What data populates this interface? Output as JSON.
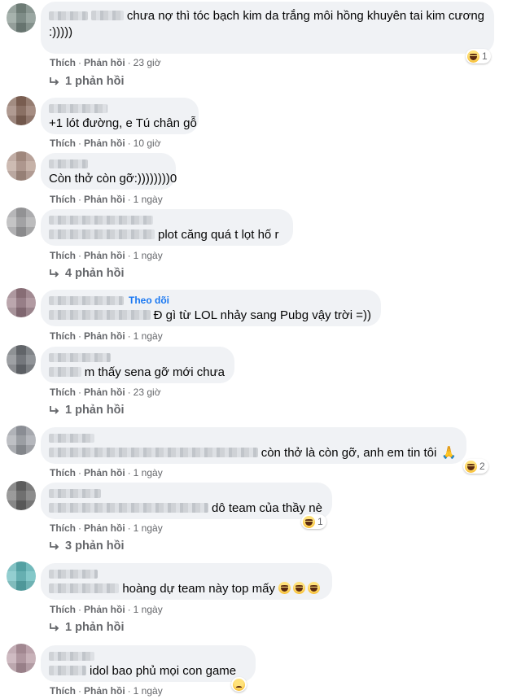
{
  "comments": [
    {
      "avatar_color": "#7c8c86",
      "lines": [
        {
          "text": "chưa nợ thì tóc bạch kim da trắng môi hồng khuyên tai kim cương"
        },
        {
          "text": ":)))))"
        }
      ],
      "actions": {
        "like": "Thích",
        "reply": "Phản hồi",
        "time": "23 giờ"
      },
      "reaction": {
        "icon": "haha-icon",
        "count": "1"
      },
      "replies": "1 phản hồi"
    },
    {
      "avatar_color": "#8a6a5c",
      "lines": [
        {
          "text": ""
        },
        {
          "text": "+1 lót đường, e Tú chân gỗ"
        }
      ],
      "actions": {
        "like": "Thích",
        "reply": "Phản hồi",
        "time": "10 giờ"
      }
    },
    {
      "avatar_color": "#b59a8e",
      "lines": [
        {
          "text": ""
        },
        {
          "text": "Còn thở còn gỡ:))))))))0"
        }
      ],
      "actions": {
        "like": "Thích",
        "reply": "Phản hồi",
        "time": "1 ngày"
      }
    },
    {
      "avatar_color": "#a7a7a9",
      "lines": [
        {
          "text": ""
        },
        {
          "text": "plot căng quá t lọt hố r"
        }
      ],
      "actions": {
        "like": "Thích",
        "reply": "Phản hồi",
        "time": "1 ngày"
      },
      "replies": "4 phản hồi"
    },
    {
      "avatar_color": "#9a7c86",
      "lines": [
        {
          "text": "",
          "follow": "Theo dõi"
        },
        {
          "text": "Đ gì từ LOL nhảy sang Pubg vậy trời =))"
        }
      ],
      "actions": {
        "like": "Thích",
        "reply": "Phản hồi",
        "time": "1 ngày"
      }
    },
    {
      "avatar_color": "#6f7378",
      "lines": [
        {
          "text": ""
        },
        {
          "text": "m thấy sena gỡ mới chưa"
        }
      ],
      "actions": {
        "like": "Thích",
        "reply": "Phản hồi",
        "time": "23 giờ"
      },
      "replies": "1 phản hồi"
    },
    {
      "avatar_color": "#9ea1a8",
      "lines": [
        {
          "text": ""
        },
        {
          "text": "còn thở là còn gỡ, anh em tin tôi",
          "emoji": "🙏"
        }
      ],
      "actions": {
        "like": "Thích",
        "reply": "Phản hồi",
        "time": "1 ngày"
      },
      "reaction": {
        "icon": "haha-icon",
        "count": "2"
      }
    },
    {
      "avatar_color": "#6a6a6a",
      "lines": [
        {
          "text": ""
        },
        {
          "text": "dô team của thầy nè"
        }
      ],
      "actions": {
        "like": "Thích",
        "reply": "Phản hồi",
        "time": "1 ngày"
      },
      "reaction": {
        "icon": "haha-icon",
        "count": "1"
      },
      "replies": "3 phản hồi"
    },
    {
      "avatar_color": "#5fb7b9",
      "lines": [
        {
          "text": ""
        },
        {
          "text": "hoàng dự team này top mấy"
        }
      ],
      "actions": {
        "like": "Thích",
        "reply": "Phản hồi",
        "time": "1 ngày"
      },
      "replies": "1 phản hồi"
    },
    {
      "avatar_color": "#b89aa4",
      "lines": [
        {
          "text": ""
        },
        {
          "text": "idol bao phủ mọi con game"
        }
      ],
      "actions": {
        "like": "Thích",
        "reply": "Phản hồi",
        "time": "1 ngày"
      }
    }
  ]
}
